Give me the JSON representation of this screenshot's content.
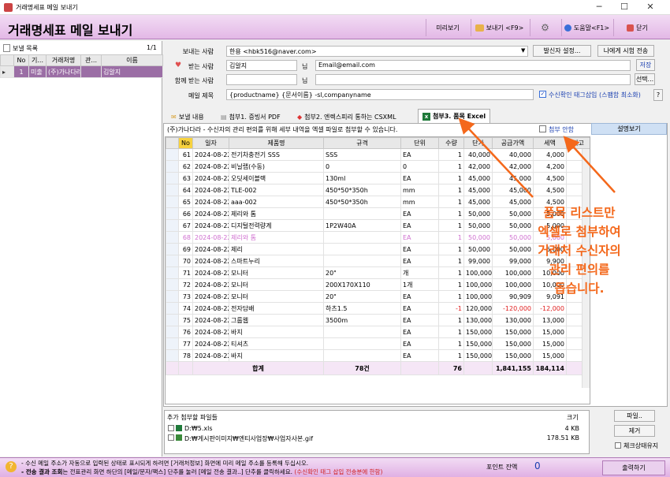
{
  "window": {
    "title": "거래명세표 메일 보내기",
    "minimize": "─",
    "maximize": "☐",
    "close": "✕"
  },
  "header": {
    "title": "거래명세표 메일 보내기",
    "preview": "미리보기",
    "send": "보내기 <F9>",
    "help": "도움말<F1>",
    "close": "닫기"
  },
  "left": {
    "title": "보낼 목록",
    "count": "1/1",
    "cols": [
      "No",
      "기...",
      "거래처명",
      "관...",
      "이름"
    ],
    "rows": [
      [
        "1",
        "미출",
        "(주)가나다라",
        "",
        "김알지"
      ]
    ]
  },
  "form": {
    "sender_label": "보내는 사람",
    "sender_value": "한용 <hbk516@naver.com>",
    "sender_settings": "발신자 설정...",
    "send_test": "나에게 시험 전송",
    "recipient_label": "받는 사람",
    "recipient_name": "김알지",
    "nim1": "님",
    "recipient_email": "Email@email.com",
    "save": "저장",
    "cc_label": "함께 받는 사람",
    "nim2": "님",
    "select": "선택...",
    "subject_label": "메일 제목",
    "subject_value": "{productname} {문서이름} -sl,companyname",
    "receipt_check": "수신확인 태그삽입 (스팸함 최소화)",
    "qmark": "?"
  },
  "tabs": [
    "보낼 내용",
    "첨부1. 증빙서 PDF",
    "첨부2. 엔렉스피리 통하는 CSXML",
    "첨부3. 품목 Excel"
  ],
  "notice": "(주)가나다라 - 수신자의 관리 편의를 위해 세부 내역을 엑셀 파일로 첨부할 수 있습니다.",
  "attach_check": "첨부 안함",
  "explain": "설명보기",
  "table": {
    "cols": [
      "No",
      "일자",
      "제품명",
      "규격",
      "단위",
      "수량",
      "단가",
      "공급가액",
      "세액",
      "비고"
    ],
    "rows": [
      [
        "61",
        "2024-08-22",
        "전기차충전기 SSS",
        "SSS",
        "EA",
        "1",
        "40,000",
        "40,000",
        "4,000",
        ""
      ],
      [
        "62",
        "2024-08-22",
        "비닐랩(수동)",
        "0",
        "0",
        "1",
        "42,000",
        "42,000",
        "4,200",
        ""
      ],
      [
        "63",
        "2024-08-22",
        "오딧세이블랙",
        "130ml",
        "EA",
        "1",
        "45,000",
        "45,000",
        "4,500",
        ""
      ],
      [
        "64",
        "2024-08-22",
        "TLE-002",
        "450*50*350h",
        "mm",
        "1",
        "45,000",
        "45,000",
        "4,500",
        ""
      ],
      [
        "65",
        "2024-08-22",
        "aaa-002",
        "450*50*350h",
        "mm",
        "1",
        "45,000",
        "45,000",
        "4,500",
        ""
      ],
      [
        "66",
        "2024-08-22",
        "제리와 톰",
        "",
        "EA",
        "1",
        "50,000",
        "50,000",
        "5,000",
        ""
      ],
      [
        "67",
        "2024-08-22",
        "디지털전력량계",
        "1P2W40A",
        "EA",
        "1",
        "50,000",
        "50,000",
        "5,000",
        ""
      ],
      [
        "68",
        "2024-08-22",
        "제리와 톰",
        "",
        "EA",
        "1",
        "50,000",
        "50,000",
        "5,000",
        ""
      ],
      [
        "69",
        "2024-08-22",
        "제리",
        "",
        "EA",
        "1",
        "50,000",
        "50,000",
        "5,000",
        ""
      ],
      [
        "70",
        "2024-08-22",
        "스마트누리",
        "",
        "EA",
        "1",
        "99,000",
        "99,000",
        "9,900",
        ""
      ],
      [
        "71",
        "2024-08-22",
        "모니터",
        "20\"",
        "개",
        "1",
        "100,000",
        "100,000",
        "10,000",
        ""
      ],
      [
        "72",
        "2024-08-22",
        "모니터",
        "200X170X110",
        "1개",
        "1",
        "100,000",
        "100,000",
        "10,000",
        ""
      ],
      [
        "73",
        "2024-08-22",
        "모니터",
        "20\"",
        "EA",
        "1",
        "100,000",
        "90,909",
        "9,091",
        ""
      ],
      [
        "74",
        "2024-08-22",
        "전자담배",
        "하츠1.5",
        "EA",
        "-1",
        "120,000",
        "-120,000",
        "-12,000",
        ""
      ],
      [
        "75",
        "2024-08-22",
        "그룹웹",
        "3500m",
        "EA",
        "1",
        "130,000",
        "130,000",
        "13,000",
        ""
      ],
      [
        "76",
        "2024-08-22",
        "바지",
        "",
        "EA",
        "1",
        "150,000",
        "150,000",
        "15,000",
        ""
      ],
      [
        "77",
        "2024-08-22",
        "티셔츠",
        "",
        "EA",
        "1",
        "150,000",
        "150,000",
        "15,000",
        ""
      ],
      [
        "78",
        "2024-08-22",
        "바지",
        "",
        "EA",
        "1",
        "150,000",
        "150,000",
        "15,000",
        ""
      ]
    ],
    "total": {
      "label": "합계",
      "count": "78건",
      "qty": "76",
      "supply": "1,841,155",
      "tax": "184,114"
    }
  },
  "callout": [
    "품목 리스트만",
    "엑셀로 첨부하여",
    "거래처 수신자의",
    "관리 편의를",
    "돕습니다."
  ],
  "files": {
    "title": "추가 첨부할 파일들",
    "size_header": "크기",
    "items": [
      {
        "name": "D:₩5.xls",
        "size": "4 KB"
      },
      {
        "name": "D:₩게시판이미지₩엔티사업장₩사업자사본.gif",
        "size": "178.51 KB"
      }
    ],
    "file_btn": "파일..",
    "remove_btn": "제거",
    "keep_check": "체크상태유지"
  },
  "bottom": {
    "line1": "- 수신 메일 주소가 자동으로 입력된 상태로 표시되게 하려면 [거래처정보] 화면에 미리 메일 주소를 등록해 두십시오.",
    "line2a": "- 전송 결과 조회",
    "line2b": "는 전표관리 화면 하단의 [메일/문자/팩스] 단추를 눌러 [메일 전송 결과..] 단추를 클릭하세요.",
    "line2c": "(수신확인 태그 삽입 전송분에 한함)",
    "points_label": "포인트 잔액",
    "points_value": "0",
    "send_btn": "출력하기"
  },
  "colors": {
    "accent": "#f4681b",
    "header": "#e3b8e6",
    "selected": "#9b6ea5"
  }
}
